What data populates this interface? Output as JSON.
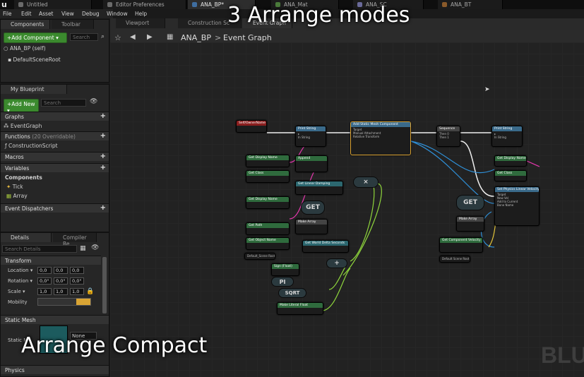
{
  "app": {
    "logo": "u",
    "tabs": [
      {
        "label": "Untitled",
        "active": false
      },
      {
        "label": "Editor Preferences",
        "active": false
      },
      {
        "label": "ANA_BP*",
        "active": true
      },
      {
        "label": "ANA_Mat",
        "active": false
      },
      {
        "label": "ANA_SC",
        "active": false
      },
      {
        "label": "ANA_BT",
        "active": false
      }
    ],
    "menu": [
      "File",
      "Edit",
      "Asset",
      "View",
      "Debug",
      "Window",
      "Help"
    ]
  },
  "components_panel": {
    "tab_label": "Components",
    "toolbar_tab": "Toolbar",
    "add_button": "+Add Component ▾",
    "search_placeholder": "Search",
    "root": "ANA_BP (self)",
    "children": [
      "DefaultSceneRoot"
    ]
  },
  "graph_tabs": {
    "viewport": "Viewport",
    "construction": "Construction Sc",
    "event_graph": "Event Graph"
  },
  "breadcrumb": {
    "asset": "ANA_BP",
    "separator": ">",
    "graph": "Event Graph"
  },
  "my_blueprint": {
    "tab_label": "My Blueprint",
    "add_button": "+Add New ▾",
    "search_placeholder": "Search",
    "graphs_label": "Graphs",
    "event_graph": "EventGraph",
    "functions_label": "Functions",
    "functions_count": "(20 Overridable)",
    "construction_script": "ConstructionScript",
    "macros_label": "Macros",
    "variables_label": "Variables",
    "components_label": "Components",
    "var_tick": "Tick",
    "var_array": "Array",
    "dispatchers_label": "Event Dispatchers"
  },
  "details": {
    "tab_label": "Details",
    "compiler_tab": "Compiler Re",
    "search_placeholder": "Search Details",
    "transform_label": "Transform",
    "location_label": "Location ▾",
    "rotation_label": "Rotation ▾",
    "scale_label": "Scale ▾",
    "mobility_label": "Mobility",
    "location": [
      "0,0",
      "0,0",
      "0,0"
    ],
    "rotation": [
      "0,0°",
      "0,0°",
      "0,0°"
    ],
    "scale": [
      "1,0",
      "1,0",
      "1,0"
    ],
    "static_mesh_section": "Static Mesh",
    "static_mesh_label": "Static M",
    "mesh_value": "None",
    "physics_label": "Physics"
  },
  "overlay": {
    "title": "3 Arrange modes",
    "subtitle": "Arrange Compact",
    "watermark": "BLU"
  },
  "nodes": {
    "self_owner": "Self/OwnerName",
    "print_string_1": "Print String",
    "add_static_mesh": "Add Static Mesh Component",
    "sequence": "Sequence",
    "print_string_2": "Print String",
    "get_display_name_1": "Get Display Name",
    "append": "Append",
    "get_class": "Get Class",
    "get_linear_damping": "Get Linear Damping",
    "get_display_name_2": "Get Display Name",
    "get_path": "Get Path",
    "make_array": "Make Array",
    "get_object_name": "Get Object Name",
    "get_world_delta": "Get World Delta Seconds",
    "default_scene_root_1": "Default_Scene Root",
    "sign": "Sign (Float)",
    "pi": "PI",
    "sqrt": "SQRT",
    "make_literal_float": "Make Literal Float",
    "get_display_name_3": "Get Display Name",
    "get_class_2": "Get Class",
    "set_physics_linear": "Set Physics Linear Velocity",
    "get_compact_1": "GET",
    "get_compact_2": "GET",
    "make_array_2": "Make Array",
    "get_component_velocity": "Get Component Velocity",
    "default_scene_root_2": "Default Scene Root",
    "compact_x": "×",
    "compact_plus": "+"
  }
}
